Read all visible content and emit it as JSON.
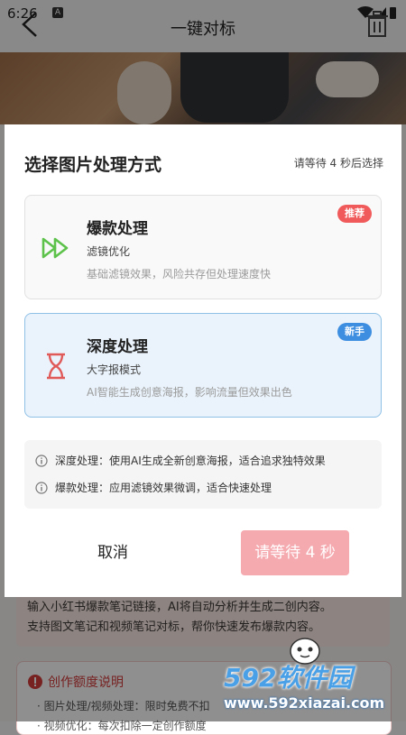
{
  "status_bar": {
    "time": "6:26",
    "a_label": "A"
  },
  "header": {
    "title": "一键对标"
  },
  "intro": {
    "line1": "输入小红书爆款笔记链接，AI将自动分析并生成二创内容。",
    "line2": "支持图文笔记和视频笔记对标，帮你快速发布爆款内容。"
  },
  "quota": {
    "title": "创作额度说明",
    "line1": "· 图片处理/视频处理：限时免费不扣",
    "line2": "· 视频优化：每次扣除一定创作额度"
  },
  "dialog": {
    "title": "选择图片处理方式",
    "wait_hint": "请等待 4 秒后选择",
    "options": [
      {
        "title": "爆款处理",
        "subtitle": "滤镜优化",
        "description": "基础滤镜效果，风险共存但处理速度快",
        "badge": "推荐",
        "icon": "fast-forward-icon"
      },
      {
        "title": "深度处理",
        "subtitle": "大字报模式",
        "description": "AI智能生成创意海报，影响流量但效果出色",
        "badge": "新手",
        "icon": "hourglass-icon"
      }
    ],
    "info": [
      "深度处理：使用AI生成全新创意海报，适合追求独特效果",
      "爆款处理：应用滤镜效果微调，适合快速处理"
    ],
    "cancel_label": "取消",
    "wait_button_label": "请等待 4 秒"
  },
  "watermark": {
    "brand": "592软件园",
    "url": "www.592xiazai.com"
  },
  "colors": {
    "accent_red": "#f05a5a",
    "accent_blue": "#3d8ee0",
    "wait_button": "#f5aab0",
    "selected_card_bg": "#eaf3fb"
  }
}
